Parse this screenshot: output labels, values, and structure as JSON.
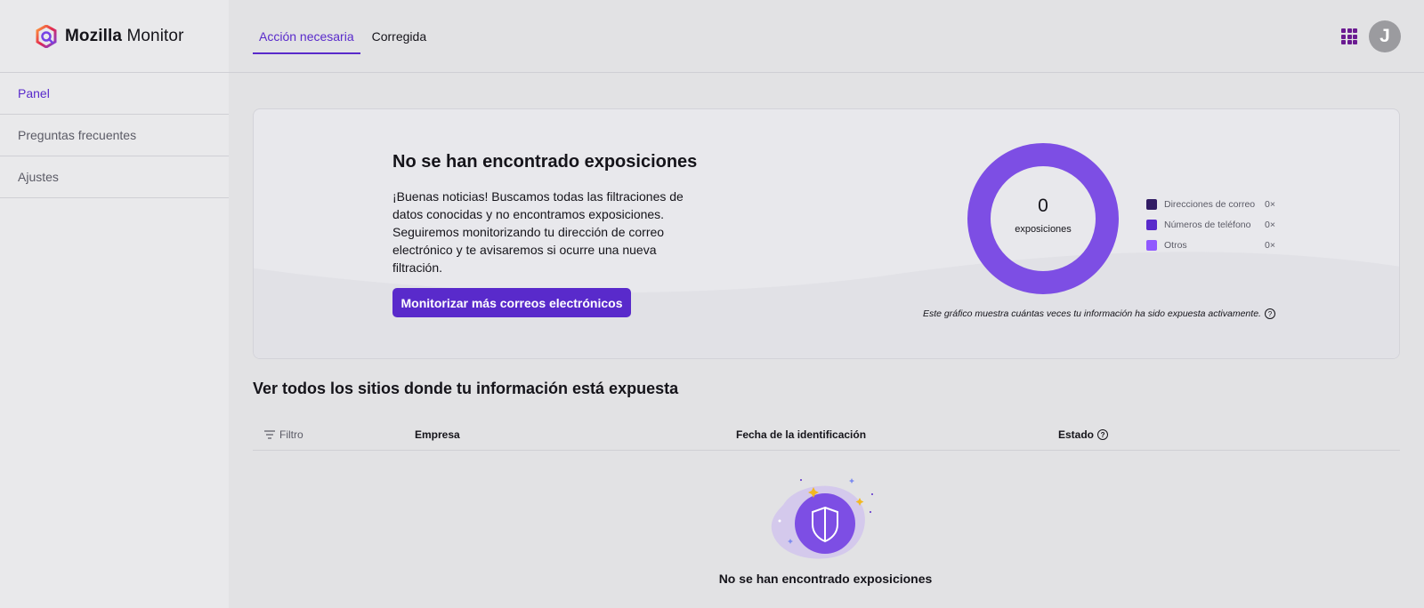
{
  "app": {
    "logo_bold": "Mozilla",
    "logo_light": "Monitor"
  },
  "sidebar": {
    "items": [
      {
        "label": "Panel"
      },
      {
        "label": "Preguntas frecuentes"
      },
      {
        "label": "Ajustes"
      }
    ]
  },
  "header": {
    "tabs": [
      {
        "label": "Acción necesaria"
      },
      {
        "label": "Corregida"
      }
    ],
    "avatar_initial": "J"
  },
  "summary": {
    "title": "No se han encontrado exposiciones",
    "description": "¡Buenas noticias! Buscamos todas las filtraciones de datos conocidas y no encontramos exposiciones. Seguiremos monitorizando tu dirección de correo electrónico y te avisaremos si ocurre una nueva filtración.",
    "button_label": "Monitorizar más correos electrónicos",
    "chart_note": "Este gráfico muestra cuántas veces tu información ha sido expuesta activamente."
  },
  "chart_data": {
    "type": "pie",
    "total": "0",
    "total_label": "exposiciones",
    "categories": [
      "Direcciones de correo",
      "Números de teléfono",
      "Otros"
    ],
    "values": [
      0,
      0,
      0
    ],
    "value_labels": [
      "0×",
      "0×",
      "0×"
    ],
    "colors": [
      "#321c64",
      "#592acb",
      "#9059ff"
    ],
    "ring_color": "#7d4ee4"
  },
  "exposures": {
    "section_title": "Ver todos los sitios donde tu información está expuesta",
    "filter_label": "Filtro",
    "columns": [
      "Empresa",
      "Fecha de la identificación",
      "Estado"
    ],
    "empty_text": "No se han encontrado exposiciones"
  },
  "colors": {
    "accent": "#592acb"
  }
}
